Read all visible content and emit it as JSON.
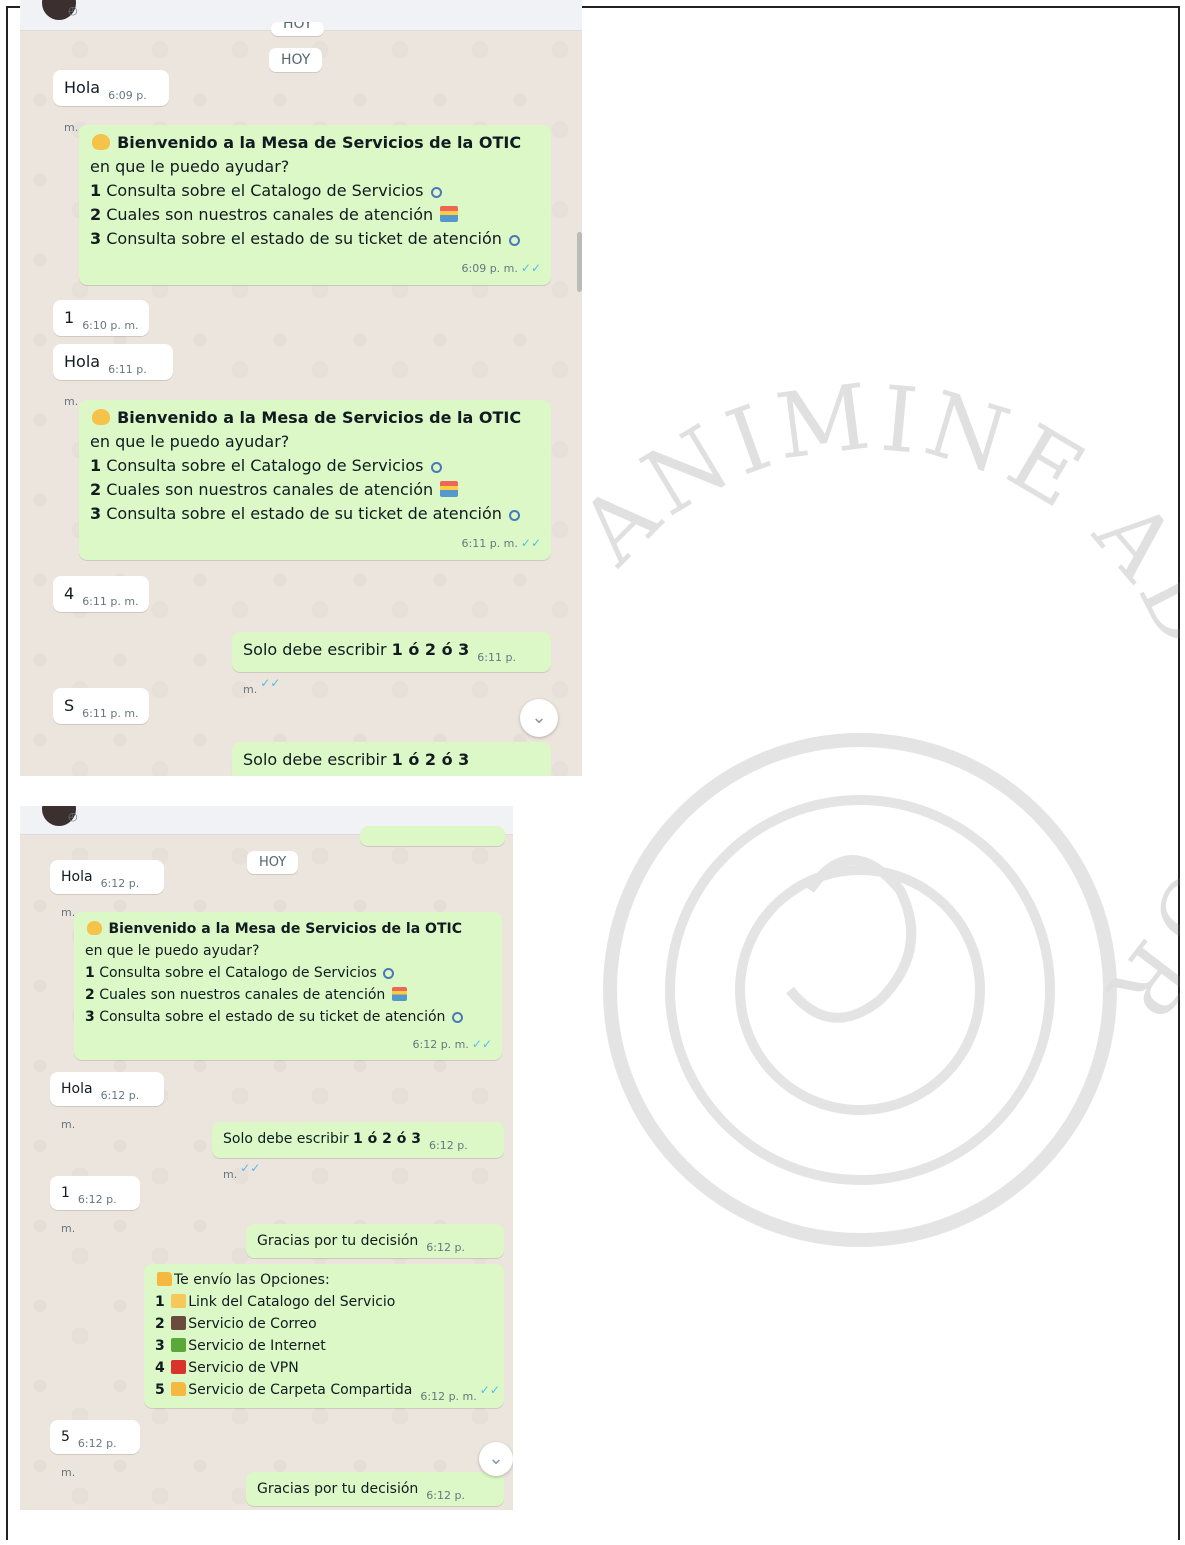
{
  "shot1": {
    "date_chip_partial": "HOY",
    "date_chip": "HOY",
    "messages": [
      {
        "dir": "in",
        "text": "Hola",
        "time": "6:09 p. m."
      },
      {
        "dir": "out",
        "type": "menu",
        "time": "6:09 p. m."
      },
      {
        "dir": "in",
        "text": "1",
        "time": "6:10 p. m."
      },
      {
        "dir": "in",
        "text": "Hola",
        "time": "6:11 p. m."
      },
      {
        "dir": "out",
        "type": "menu",
        "time": "6:11 p. m."
      },
      {
        "dir": "in",
        "text": "4",
        "time": "6:11 p. m."
      },
      {
        "dir": "out",
        "type": "solo",
        "time": "6:11 p. m."
      },
      {
        "dir": "in",
        "text": "S",
        "time": "6:11 p. m."
      },
      {
        "dir": "out",
        "type": "solo",
        "time": ""
      }
    ],
    "scroll_down_icon": "chevron-down-icon"
  },
  "menu": {
    "welcome": "Bienvenido a la Mesa de Servicios de la OTIC",
    "prompt": "en que le puedo ayudar?",
    "options": [
      {
        "num": "1",
        "text": "Consulta sobre el Catalogo de Servicios",
        "icon": "magnifier-icon"
      },
      {
        "num": "2",
        "text": "Cuales son nuestros canales de atención",
        "icon": "file-cabinet-icon"
      },
      {
        "num": "3",
        "text": "Consulta sobre el estado de su ticket de atención",
        "icon": "magnifier-icon"
      }
    ]
  },
  "solo": {
    "prefix": "Solo debe escribir",
    "bold": "1 ó 2 ó 3"
  },
  "shot2": {
    "date_chip": "HOY",
    "messages": [
      {
        "dir": "in",
        "text": "Hola",
        "time": "6:12 p. m."
      },
      {
        "dir": "out",
        "type": "menu",
        "time": "6:12 p. m."
      },
      {
        "dir": "in",
        "text": "Hola",
        "time": "6:12 p. m."
      },
      {
        "dir": "out",
        "type": "solo",
        "time": "6:12 p. m."
      },
      {
        "dir": "in",
        "text": "1",
        "time": "6:12 p. m."
      },
      {
        "dir": "out",
        "text": "Gracias por tu decisión",
        "time": "6:12 p. m."
      },
      {
        "dir": "out",
        "type": "options",
        "time": "6:12 p. m."
      },
      {
        "dir": "in",
        "text": "5",
        "time": "6:12 p. m."
      },
      {
        "dir": "out",
        "text": "Gracias por tu decisión",
        "time": "6:12 p. m."
      }
    ]
  },
  "options": {
    "header": "Te envío las Opciones:",
    "items": [
      {
        "num": "1",
        "text": "Link del Catalogo del Servicio",
        "icon": "ledger-icon"
      },
      {
        "num": "2",
        "text": "Servicio de Correo",
        "icon": "mailbox-icon"
      },
      {
        "num": "3",
        "text": "Servicio de Internet",
        "icon": "green-book-icon"
      },
      {
        "num": "4",
        "text": "Servicio de VPN",
        "icon": "red-book-icon"
      },
      {
        "num": "5",
        "text": "Servicio de Carpeta Compartida",
        "icon": "folder-icon"
      }
    ]
  },
  "watermark": {
    "text": "ANIMINE AD AMORIS VITAM"
  },
  "colors": {
    "incoming": "#ffffff",
    "outgoing": "#dcf8c6",
    "chat_bg": "#ece5dd",
    "read_ticks": "#53bdeb"
  }
}
